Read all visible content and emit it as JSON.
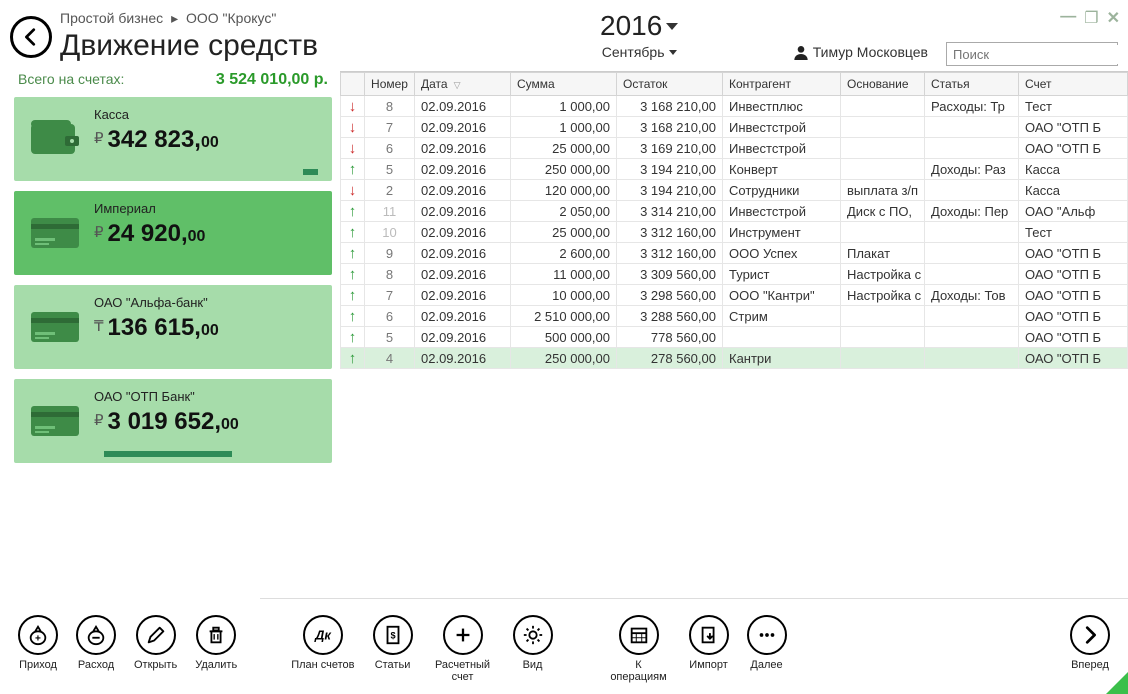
{
  "breadcrumb": {
    "app": "Простой бизнес",
    "company": "ООО \"Крокус\""
  },
  "page_title": "Движение средств",
  "year": "2016",
  "month": "Сентябрь",
  "user": "Тимур Московцев",
  "search_placeholder": "Поиск",
  "totals": {
    "label": "Всего на счетах:",
    "amount": "3 524 010,00 р."
  },
  "accounts": [
    {
      "name": "Касса",
      "currency": "₽",
      "int": "342 823,",
      "cents": "00",
      "icon": "wallet",
      "active": false,
      "bar_pct": 7,
      "bar_align": "right"
    },
    {
      "name": "Империал",
      "currency": "₽",
      "int": "24 920,",
      "cents": "00",
      "icon": "card",
      "active": true,
      "bar_pct": 0
    },
    {
      "name": "ОАО \"Альфа-банк\"",
      "currency": "₸",
      "int": "136 615,",
      "cents": "00",
      "icon": "card",
      "active": false,
      "bar_pct": 0
    },
    {
      "name": "ОАО \"ОТП Банк\"",
      "currency": "₽",
      "int": "3 019 652,",
      "cents": "00",
      "icon": "card",
      "active": false,
      "bar_pct": 60,
      "bar_align": "left"
    }
  ],
  "columns": [
    "",
    "Номер",
    "Дата",
    "Сумма",
    "Остаток",
    "Контрагент",
    "Основание",
    "Статья",
    "Счет"
  ],
  "rows": [
    {
      "dir": "down",
      "num": "8",
      "date": "02.09.2016",
      "sum": "1 000,00",
      "bal": "3 168 210,00",
      "contr": "Инвестплюс",
      "reason": "",
      "article": "Расходы: Тр",
      "acct": "Тест"
    },
    {
      "dir": "down",
      "num": "7",
      "date": "02.09.2016",
      "sum": "1 000,00",
      "bal": "3 168 210,00",
      "contr": "Инвестстрой",
      "reason": "",
      "article": "",
      "acct": "ОАО \"ОТП Б"
    },
    {
      "dir": "down",
      "num": "6",
      "date": "02.09.2016",
      "sum": "25 000,00",
      "bal": "3 169 210,00",
      "contr": "Инвестстрой",
      "reason": "",
      "article": "",
      "acct": "ОАО \"ОТП Б"
    },
    {
      "dir": "up",
      "num": "5",
      "date": "02.09.2016",
      "sum": "250 000,00",
      "bal": "3 194 210,00",
      "contr": "Конверт",
      "reason": "",
      "article": "Доходы: Раз",
      "acct": "Касса"
    },
    {
      "dir": "down",
      "num": "2",
      "date": "02.09.2016",
      "sum": "120 000,00",
      "bal": "3 194 210,00",
      "contr": "Сотрудники",
      "reason": "выплата з/п",
      "article": "",
      "acct": "Касса"
    },
    {
      "dir": "up",
      "num": "11",
      "date": "02.09.2016",
      "sum": "2 050,00",
      "bal": "3 314 210,00",
      "contr": "Инвестстрой",
      "reason": "Диск с ПО,",
      "article": "Доходы: Пер",
      "acct": "ОАО \"Альф",
      "gray": true
    },
    {
      "dir": "up",
      "num": "10",
      "date": "02.09.2016",
      "sum": "25 000,00",
      "bal": "3 312 160,00",
      "contr": "Инструмент",
      "reason": "",
      "article": "",
      "acct": "Тест",
      "gray": true
    },
    {
      "dir": "up",
      "num": "9",
      "date": "02.09.2016",
      "sum": "2 600,00",
      "bal": "3 312 160,00",
      "contr": "ООО Успех",
      "reason": "Плакат",
      "article": "",
      "acct": "ОАО \"ОТП Б"
    },
    {
      "dir": "up",
      "num": "8",
      "date": "02.09.2016",
      "sum": "11 000,00",
      "bal": "3 309 560,00",
      "contr": "Турист",
      "reason": "Настройка с",
      "article": "",
      "acct": "ОАО \"ОТП Б"
    },
    {
      "dir": "up",
      "num": "7",
      "date": "02.09.2016",
      "sum": "10 000,00",
      "bal": "3 298 560,00",
      "contr": "ООО \"Кантри\"",
      "reason": "Настройка с",
      "article": "Доходы: Тов",
      "acct": "ОАО \"ОТП Б"
    },
    {
      "dir": "up",
      "num": "6",
      "date": "02.09.2016",
      "sum": "2 510 000,00",
      "bal": "3 288 560,00",
      "contr": "Стрим",
      "reason": "",
      "article": "",
      "acct": "ОАО \"ОТП Б"
    },
    {
      "dir": "up",
      "num": "5",
      "date": "02.09.2016",
      "sum": "500 000,00",
      "bal": "778 560,00",
      "contr": "",
      "reason": "",
      "article": "",
      "acct": "ОАО \"ОТП Б"
    },
    {
      "dir": "up",
      "num": "4",
      "date": "02.09.2016",
      "sum": "250 000,00",
      "bal": "278 560,00",
      "contr": "Кантри",
      "reason": "",
      "article": "",
      "acct": "ОАО \"ОТП Б",
      "sel": true
    }
  ],
  "toolbar": [
    {
      "id": "income",
      "label": "Приход",
      "icon": "plus-bag"
    },
    {
      "id": "expense",
      "label": "Расход",
      "icon": "minus-bag"
    },
    {
      "id": "open",
      "label": "Открыть",
      "icon": "pencil"
    },
    {
      "id": "delete",
      "label": "Удалить",
      "icon": "trash"
    },
    {
      "id": "plan",
      "label": "План счетов",
      "icon": "dk"
    },
    {
      "id": "articles",
      "label": "Статьи",
      "icon": "doc-money"
    },
    {
      "id": "racct",
      "label": "Расчетный счет",
      "icon": "plus"
    },
    {
      "id": "view",
      "label": "Вид",
      "icon": "gear"
    },
    {
      "id": "ops",
      "label": "К операциям",
      "icon": "calendar"
    },
    {
      "id": "import",
      "label": "Импорт",
      "icon": "import"
    },
    {
      "id": "more",
      "label": "Далее",
      "icon": "dots"
    }
  ],
  "forward": "Вперед"
}
